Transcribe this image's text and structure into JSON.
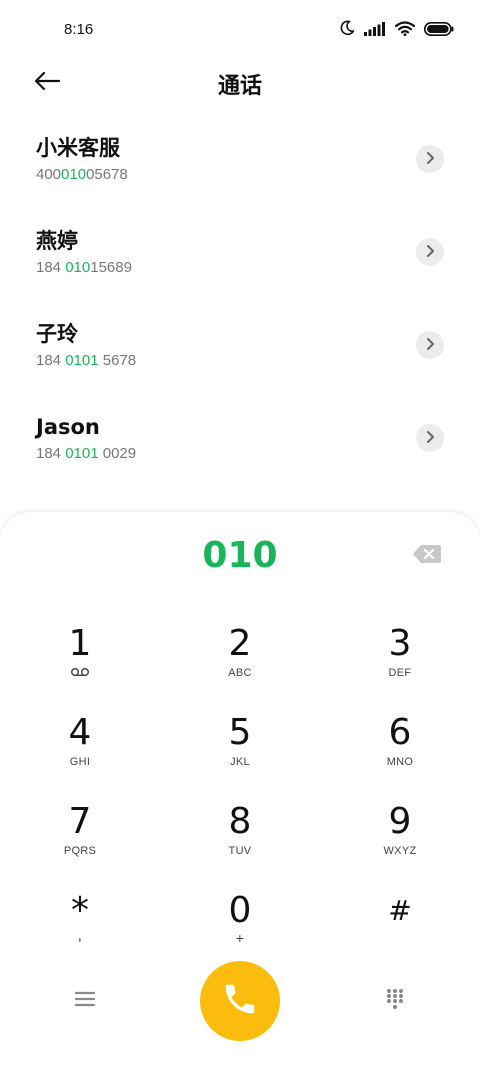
{
  "status_bar": {
    "time": "8:16",
    "icons": [
      "moon-icon",
      "signal-icon",
      "wifi-icon",
      "battery-icon"
    ]
  },
  "header": {
    "title": "通话",
    "back_icon": "back-arrow-icon"
  },
  "contacts": [
    {
      "name": "小米客服",
      "number_pre": "400",
      "number_match": "010",
      "number_post": "05678"
    },
    {
      "name": "燕婷",
      "number_pre": "184 ",
      "number_match": "010",
      "number_post": "15689"
    },
    {
      "name": "子玲",
      "number_pre": "184 ",
      "number_match": "0101",
      "number_post": " 5678"
    },
    {
      "name": "Jason",
      "number_pre": "184 ",
      "number_match": "0101",
      "number_post": " 0029"
    }
  ],
  "dialpad": {
    "input_value": "010",
    "keys": [
      {
        "digit": "1",
        "letters": ""
      },
      {
        "digit": "2",
        "letters": "ABC"
      },
      {
        "digit": "3",
        "letters": "DEF"
      },
      {
        "digit": "4",
        "letters": "GHI"
      },
      {
        "digit": "5",
        "letters": "JKL"
      },
      {
        "digit": "6",
        "letters": "MNO"
      },
      {
        "digit": "7",
        "letters": "PQRS"
      },
      {
        "digit": "8",
        "letters": "TUV"
      },
      {
        "digit": "9",
        "letters": "WXYZ"
      },
      {
        "digit": "*",
        "letters": ","
      },
      {
        "digit": "0",
        "letters": "+"
      },
      {
        "digit": "#",
        "letters": ""
      }
    ]
  },
  "colors": {
    "match_green": "#18b55a",
    "call_yellow": "#fbbc0e",
    "detail_button_bg": "#ececec"
  }
}
